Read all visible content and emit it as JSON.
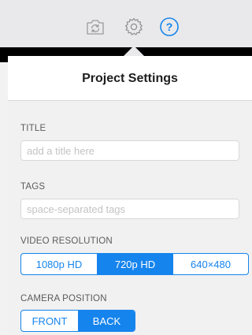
{
  "toolbar": {
    "icons": [
      "camera-flip-icon",
      "gear-icon",
      "help-icon"
    ]
  },
  "popover": {
    "title": "Project Settings"
  },
  "title_section": {
    "label": "TITLE",
    "value": "",
    "placeholder": "add a title here"
  },
  "tags_section": {
    "label": "TAGS",
    "value": "",
    "placeholder": "space-separated tags"
  },
  "video_resolution": {
    "label": "VIDEO RESOLUTION",
    "options": [
      "1080p HD",
      "720p HD",
      "640×480"
    ],
    "selected": "720p HD"
  },
  "camera_position": {
    "label": "CAMERA POSITION",
    "options": [
      "FRONT",
      "BACK"
    ],
    "selected": "BACK"
  },
  "colors": {
    "accent": "#1684ed",
    "toolbar_bg": "#e9e9eb",
    "panel_bg": "#f1f1f1"
  }
}
